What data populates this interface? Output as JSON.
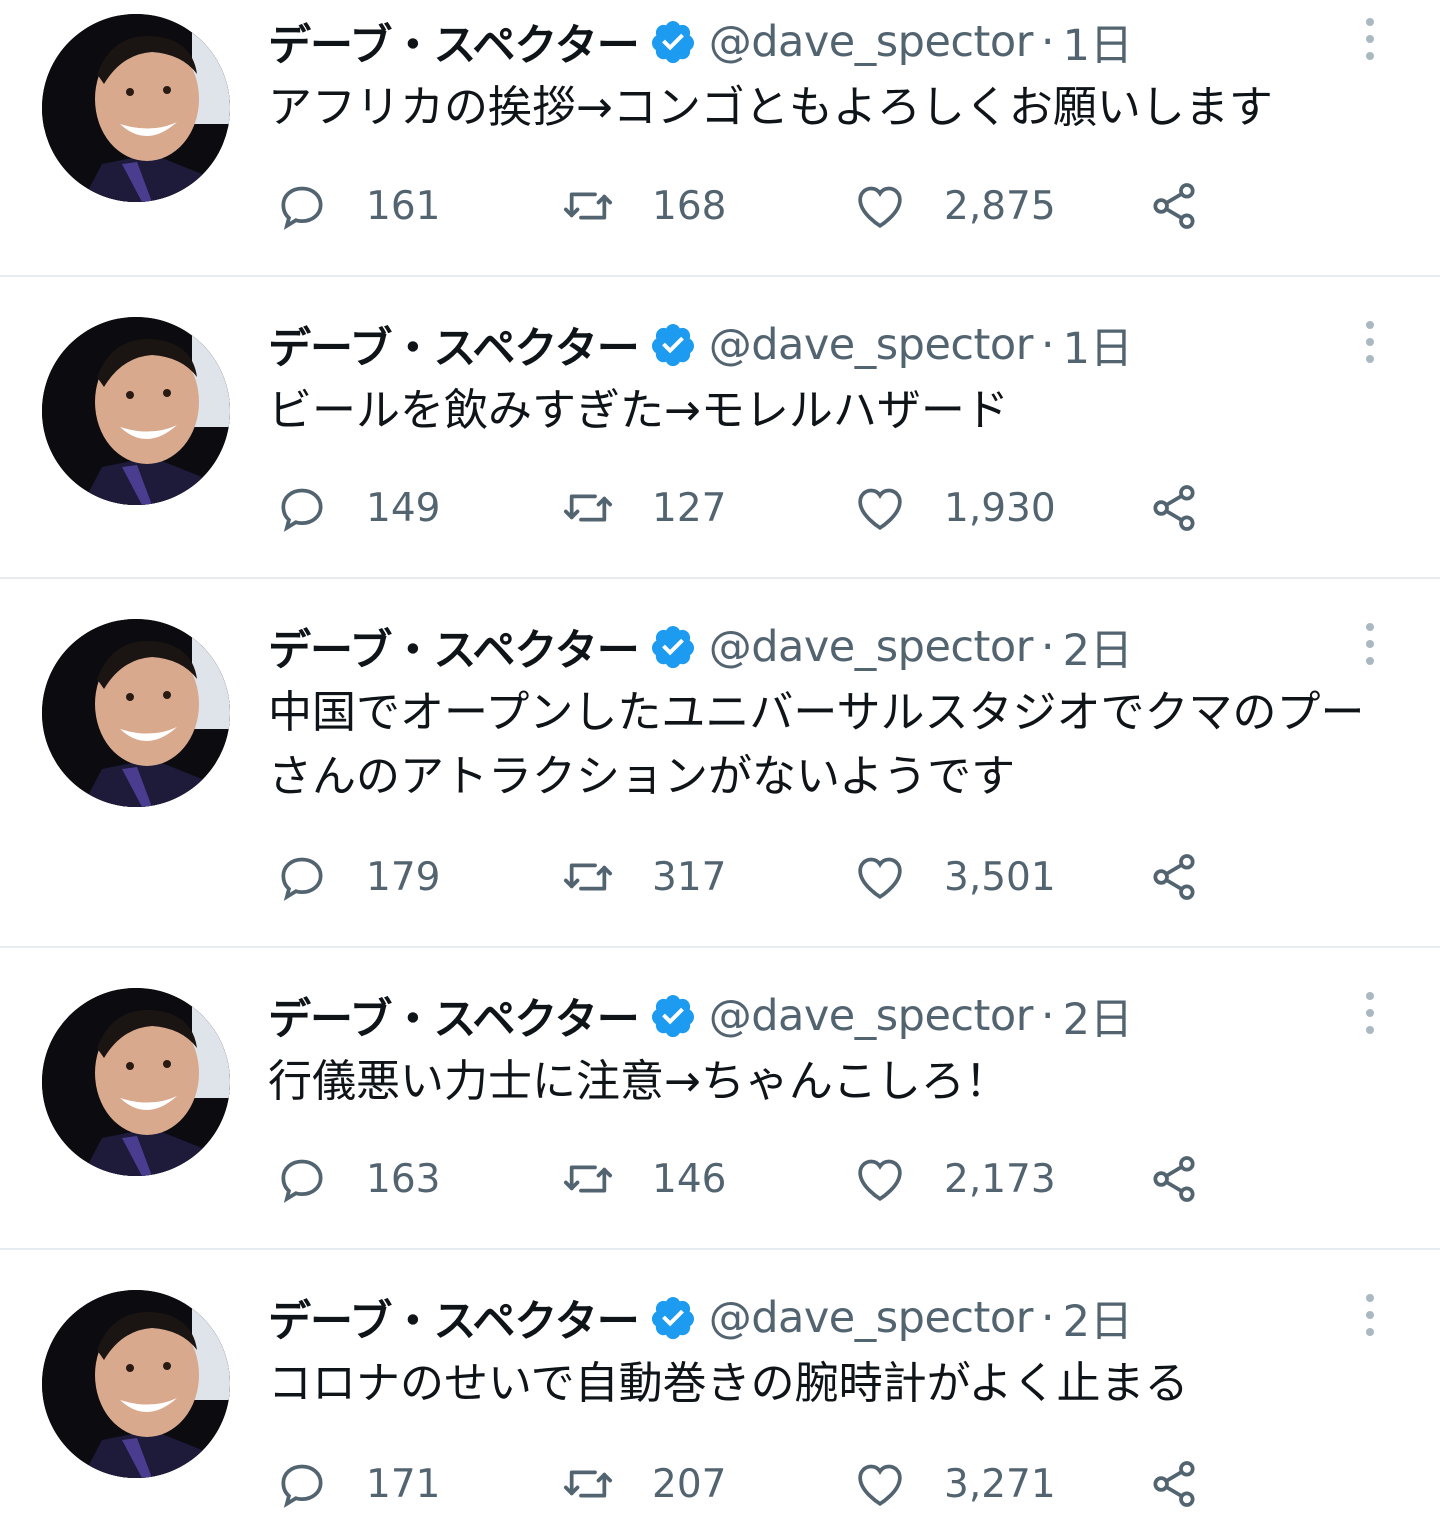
{
  "tweets": [
    {
      "name": "デーブ・スペクター",
      "handle": "@dave_spector",
      "sep": "·",
      "time": "1日",
      "text": "アフリカの挨拶→コンゴともよろしくお願いします",
      "replies": "161",
      "retweets": "168",
      "likes": "2,875"
    },
    {
      "name": "デーブ・スペクター",
      "handle": "@dave_spector",
      "sep": "·",
      "time": "1日",
      "text": "ビールを飲みすぎた→モレルハザード",
      "replies": "149",
      "retweets": "127",
      "likes": "1,930"
    },
    {
      "name": "デーブ・スペクター",
      "handle": "@dave_spector",
      "sep": "·",
      "time": "2日",
      "text": "中国でオープンしたユニバーサルスタジオでクマのプーさんのアトラクションがないようです",
      "replies": "179",
      "retweets": "317",
      "likes": "3,501"
    },
    {
      "name": "デーブ・スペクター",
      "handle": "@dave_spector",
      "sep": "·",
      "time": "2日",
      "text": "行儀悪い力士に注意→ちゃんこしろ！",
      "replies": "163",
      "retweets": "146",
      "likes": "2,173"
    },
    {
      "name": "デーブ・スペクター",
      "handle": "@dave_spector",
      "sep": "·",
      "time": "2日",
      "text": "コロナのせいで自動巻きの腕時計がよく止まる",
      "replies": "171",
      "retweets": "207",
      "likes": "3,271"
    }
  ],
  "icons": {
    "verified": "verified-badge-icon",
    "more": "more-vertical-icon",
    "reply": "reply-icon",
    "retweet": "retweet-icon",
    "like": "heart-icon",
    "share": "share-icon"
  },
  "colors": {
    "verified": "#1d9bf0",
    "text": "#0f1419",
    "muted": "#536471",
    "divider": "#e6ecf0",
    "icon": "#536471"
  }
}
